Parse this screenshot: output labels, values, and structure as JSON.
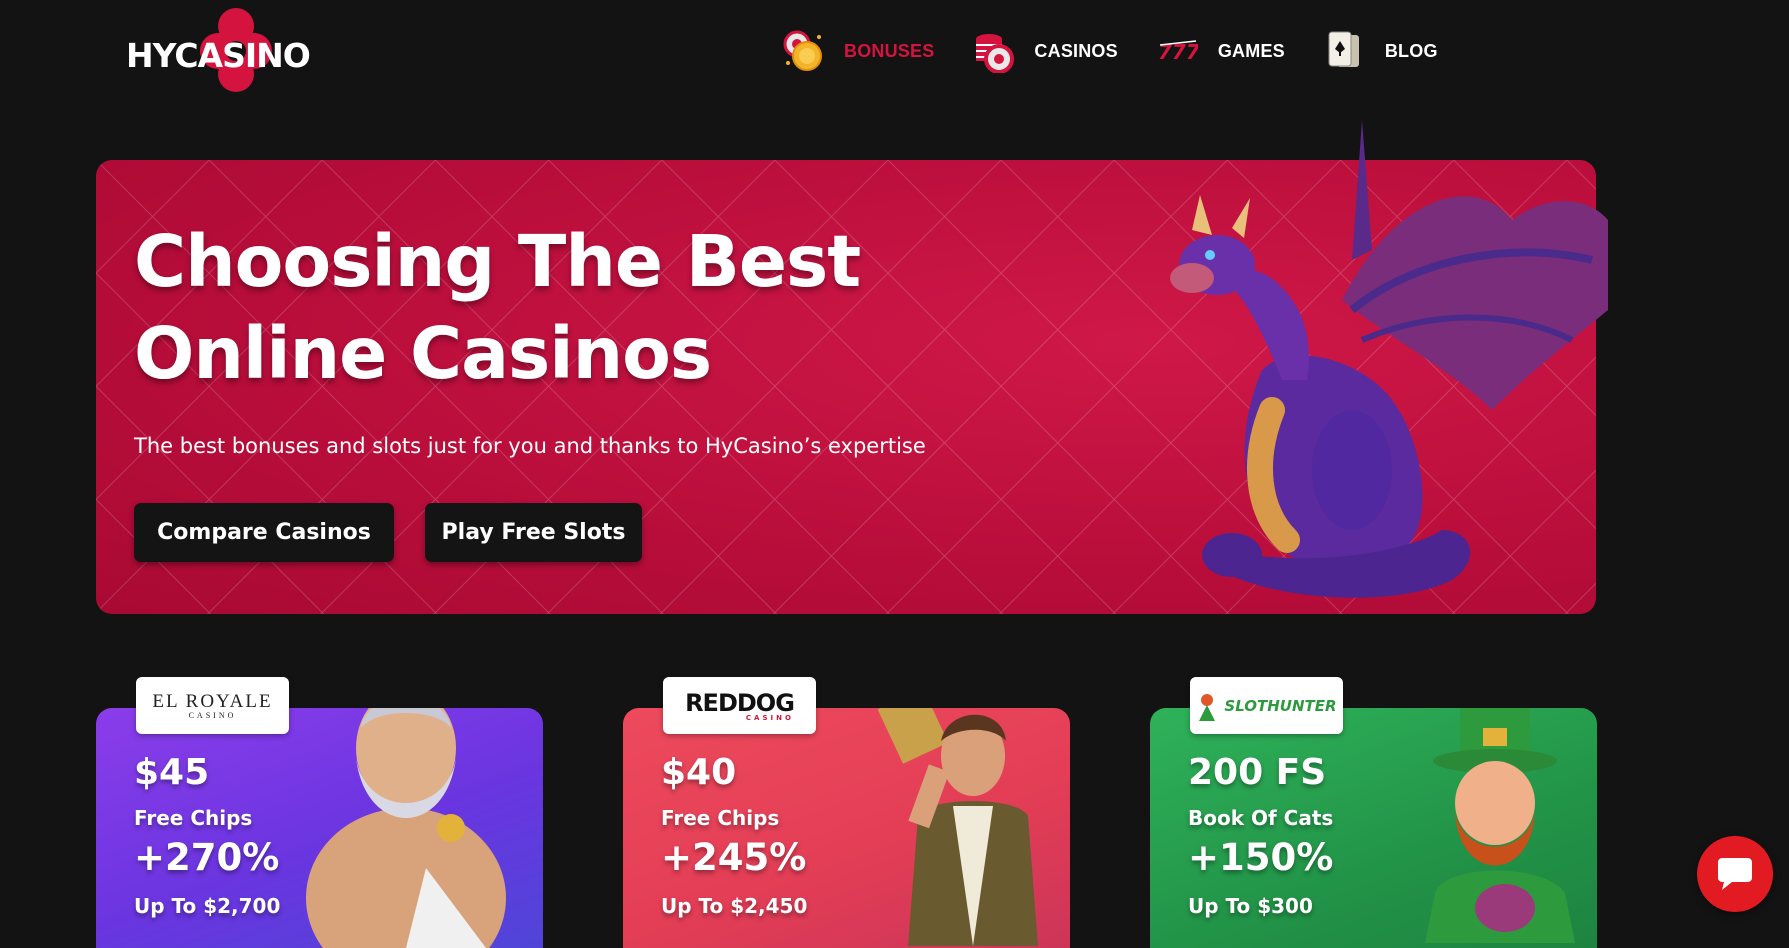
{
  "brand": {
    "name": "HYCASINO",
    "accent": "#d4143f"
  },
  "nav": {
    "items": [
      {
        "label": "BONUSES",
        "icon": "coins-icon",
        "active": true
      },
      {
        "label": "CASINOS",
        "icon": "chips-icon",
        "active": false
      },
      {
        "label": "GAMES",
        "icon": "slot-777-icon",
        "active": false
      },
      {
        "label": "BLOG",
        "icon": "playing-cards-icon",
        "active": false
      }
    ]
  },
  "hero": {
    "title": "Choosing The Best Online Casinos",
    "subtitle": "The best bonuses and slots just for you and thanks to HyCasino’s expertise",
    "buttons": {
      "compare": "Compare Casinos",
      "slots": "Play Free Slots"
    },
    "background": "#b80d3a"
  },
  "cards": [
    {
      "casino_logo": "EL ROYALE",
      "casino_logo_sub": "CASINO",
      "amount": "$45",
      "description": "Free Chips",
      "percent": "+270%",
      "up_to": "Up To $2,700",
      "color": "#6a35e0"
    },
    {
      "casino_logo": "REDDOG",
      "casino_logo_sub": "CASINO",
      "amount": "$40",
      "description": "Free Chips",
      "percent": "+245%",
      "up_to": "Up To $2,450",
      "color": "#e23d56"
    },
    {
      "casino_logo": "SLOTHUNTER",
      "casino_logo_sub": "",
      "amount": "200 FS",
      "description": "Book Of Cats",
      "percent": "+150%",
      "up_to": "Up To $300",
      "color": "#229448"
    }
  ],
  "chat": {
    "icon": "chat-bubble-icon",
    "color": "#e21b23"
  }
}
